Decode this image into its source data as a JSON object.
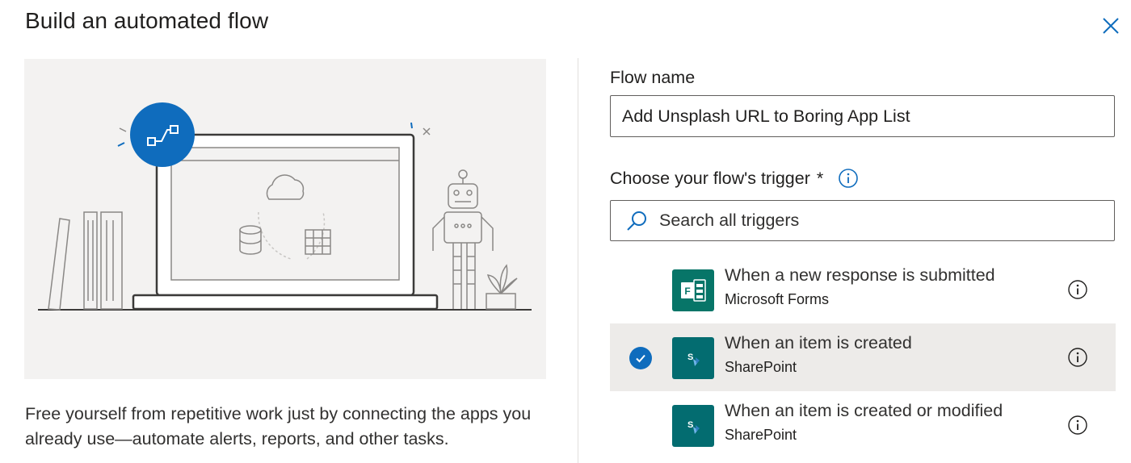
{
  "dialog": {
    "title": "Build an automated flow",
    "description": "Free yourself from repetitive work just by connecting the apps you already use—automate alerts, reports, and other tasks."
  },
  "form": {
    "flow_name_label": "Flow name",
    "flow_name_value": "Add Unsplash URL to Boring App List",
    "trigger_label": "Choose your flow's trigger",
    "required_mark": "*",
    "search_placeholder": "Search all triggers"
  },
  "triggers": [
    {
      "title": "When a new response is submitted",
      "connector": "Microsoft Forms",
      "icon": "microsoft-forms-icon",
      "selected": false
    },
    {
      "title": "When an item is created",
      "connector": "SharePoint",
      "icon": "sharepoint-icon",
      "selected": true
    },
    {
      "title": "When an item is created or modified",
      "connector": "SharePoint",
      "icon": "sharepoint-icon",
      "selected": false
    }
  ],
  "colors": {
    "accent": "#0f6cbd",
    "illustration_bg": "#f3f2f1",
    "selected_row": "#edebe9",
    "sharepoint_tile": "#036c70",
    "forms_tile": "#077568"
  }
}
